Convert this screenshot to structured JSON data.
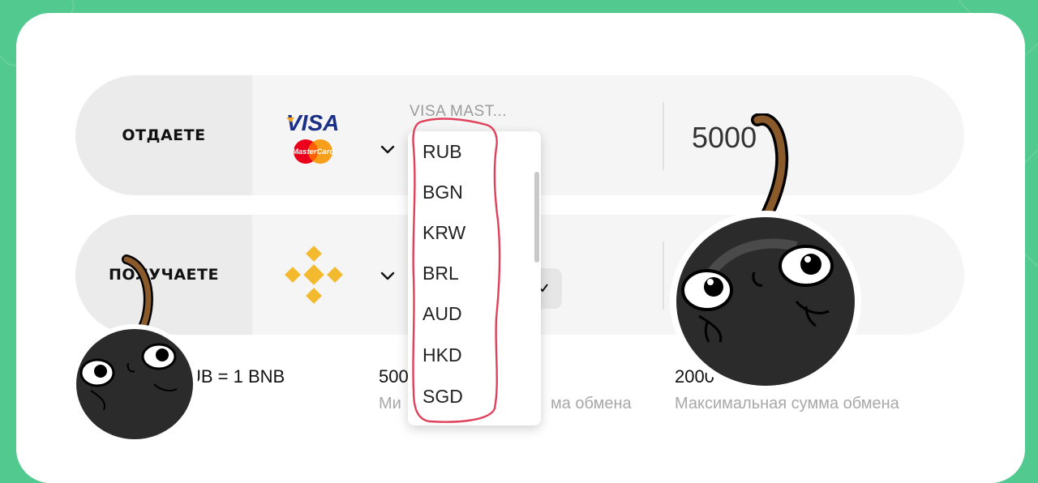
{
  "give": {
    "label": "ОТДАЕТЕ",
    "method_name": "VISA MAST...",
    "amount": "5000",
    "logo_visa_text": "VISA",
    "logo_mastercard_text": "MasterCard",
    "icon": "visa-mastercard-icon"
  },
  "receive": {
    "label": "ПОЛУЧАЕТЕ",
    "icon": "binance-icon"
  },
  "currency_dropdown": {
    "options": [
      "RUB",
      "BGN",
      "KRW",
      "BRL",
      "AUD",
      "HKD",
      "SGD"
    ]
  },
  "rate": {
    "text": "UB = 1 BNB"
  },
  "min": {
    "value": "500",
    "label_left": "Ми",
    "label_right": "ма обмена"
  },
  "max": {
    "value": "2000",
    "label": "Максимальная сумма обмена"
  },
  "colors": {
    "background": "#52c98f",
    "binance": "#f3ba2f",
    "annotation": "#e0405a"
  }
}
